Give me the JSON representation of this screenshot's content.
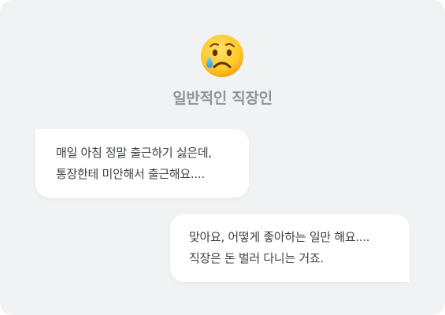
{
  "profile": {
    "avatar_icon": "crying-face-emoji",
    "name": "일반적인 직장인"
  },
  "messages": [
    {
      "side": "left",
      "lines": [
        "매일 아침 정말 출근하기 싫은데,",
        "통장한테 미안해서 출근해요...."
      ]
    },
    {
      "side": "right",
      "lines": [
        "맞아요, 어떻게 좋아하는 일만 해요....",
        "직장은 돈 벌러 다니는 거죠."
      ]
    }
  ],
  "colors": {
    "background": "#f1f2f4",
    "bubble": "#ffffff",
    "name_text": "#8e949c",
    "message_text": "#3d4148"
  }
}
